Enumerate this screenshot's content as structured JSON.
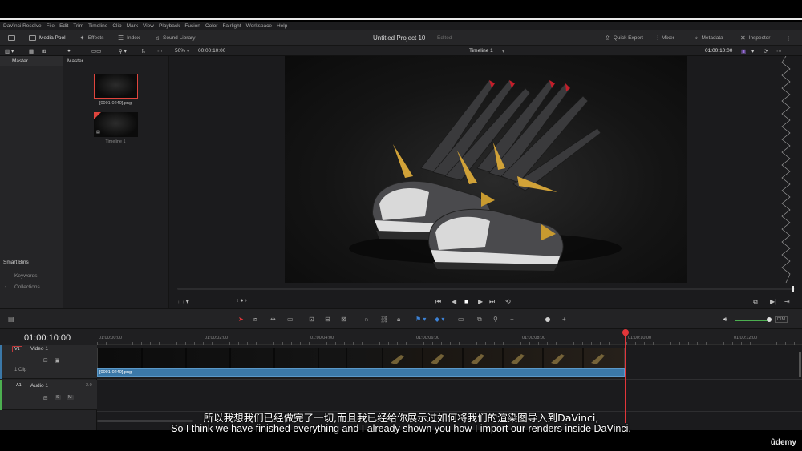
{
  "menu": [
    "DaVinci Resolve",
    "File",
    "Edit",
    "Trim",
    "Timeline",
    "Clip",
    "Mark",
    "View",
    "Playback",
    "Fusion",
    "Color",
    "Fairlight",
    "Workspace",
    "Help"
  ],
  "toolbar": {
    "media_pool": "Media Pool",
    "effects": "Effects",
    "index": "Index",
    "sound_library": "Sound Library",
    "project_title": "Untitled Project 10",
    "edited": "Edited",
    "quick_export": "Quick Export",
    "mixer": "Mixer",
    "metadata": "Metadata",
    "inspector": "Inspector"
  },
  "viewer_bar": {
    "zoom": "50%",
    "source_tc": "00:00:10:00",
    "timeline_name": "Timeline 1",
    "record_tc": "01:00:10:00"
  },
  "bins": {
    "master": "Master",
    "smart_bins": "Smart Bins",
    "keywords": "Keywords",
    "collections": "Collections"
  },
  "pool": {
    "header": "Master",
    "clip1": "[0001-0240].png",
    "clip2": "Timeline 1"
  },
  "timeline": {
    "timecode": "01:00:10:00",
    "ruler": [
      "01:00:00:00",
      "01:00:02:00",
      "01:00:04:00",
      "01:00:06:00",
      "01:00:08:00",
      "01:00:10:00",
      "01:00:12:00"
    ],
    "video_track_id": "V1",
    "video_track_name": "Video 1",
    "video_clip_count": "1 Clip",
    "clip_name": "[0001-0240].png",
    "audio_track_id": "A1",
    "audio_track_name": "Audio 1",
    "audio_level": "2.0",
    "mute": "M",
    "solo": "S",
    "dim": "DIM"
  },
  "subtitles": {
    "chinese": "所以我想我们已经做完了一切,而且我已经给你展示过如何将我们的渲染图导入到DaVinci,",
    "english": "So I think we have finished everything and I already shown you how I import our renders inside DaVinci,"
  },
  "brand": "ûdemy",
  "colors": {
    "playhead": "#e2363a",
    "clip_bar": "#3b78a8",
    "accent_green": "#4caf50"
  }
}
